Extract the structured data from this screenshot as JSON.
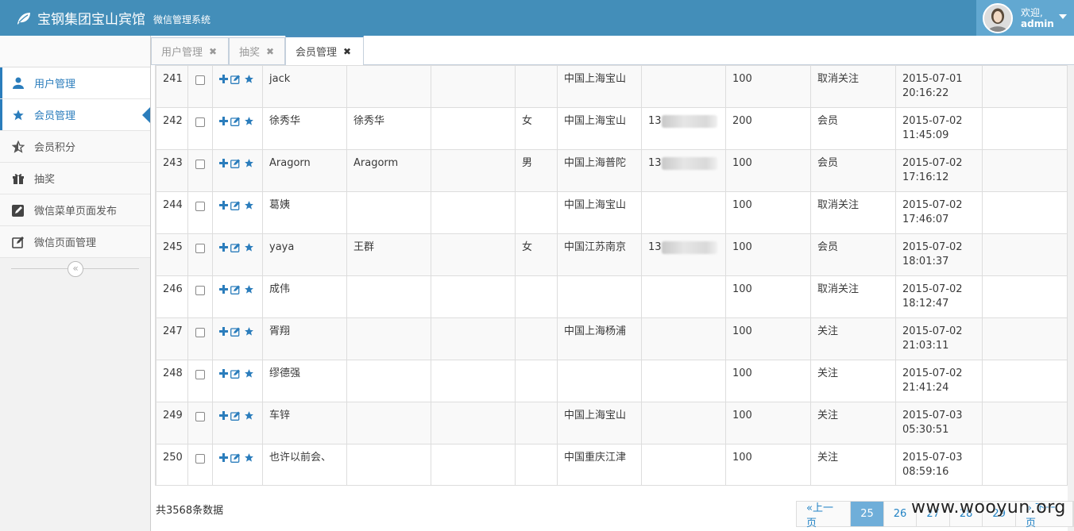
{
  "header": {
    "brand_name": "宝钢集团宝山宾馆",
    "brand_sub": "微信管理系统",
    "welcome": "欢迎,",
    "username": "admin"
  },
  "sidebar": {
    "items": [
      {
        "label": "用户管理",
        "icon": "user-icon"
      },
      {
        "label": "会员管理",
        "icon": "star-icon"
      },
      {
        "label": "会员积分",
        "icon": "star-half-icon"
      },
      {
        "label": "抽奖",
        "icon": "gift-icon"
      },
      {
        "label": "微信菜单页面发布",
        "icon": "pencil-square-icon"
      },
      {
        "label": "微信页面管理",
        "icon": "edit-icon"
      }
    ],
    "collapse_icon": "double-chevron-left-icon"
  },
  "tabs": [
    {
      "label": "用户管理"
    },
    {
      "label": "抽奖"
    },
    {
      "label": "会员管理"
    }
  ],
  "table": {
    "rows": [
      {
        "id": "241",
        "nickname": "jack",
        "name": "",
        "col5": "",
        "gender": "",
        "region": "中国上海宝山",
        "phone": "",
        "points": "100",
        "status": "取消关注",
        "date": "2015-07-01",
        "time": "20:16:22"
      },
      {
        "id": "242",
        "nickname": "徐秀华",
        "name": "徐秀华",
        "col5": "",
        "gender": "女",
        "region": "中国上海宝山",
        "phone": "13",
        "points": "200",
        "status": "会员",
        "date": "2015-07-02",
        "time": "11:45:09"
      },
      {
        "id": "243",
        "nickname": "Aragorn",
        "name": "Aragorm",
        "col5": "",
        "gender": "男",
        "region": "中国上海普陀",
        "phone": "13",
        "points": "100",
        "status": "会员",
        "date": "2015-07-02",
        "time": "17:16:12"
      },
      {
        "id": "244",
        "nickname": "葛姨",
        "name": "",
        "col5": "",
        "gender": "",
        "region": "中国上海宝山",
        "phone": "",
        "points": "100",
        "status": "取消关注",
        "date": "2015-07-02",
        "time": "17:46:07"
      },
      {
        "id": "245",
        "nickname": "yaya",
        "name": "王群",
        "col5": "",
        "gender": "女",
        "region": "中国江苏南京",
        "phone": "13",
        "points": "100",
        "status": "会员",
        "date": "2015-07-02",
        "time": "18:01:37"
      },
      {
        "id": "246",
        "nickname": "成伟",
        "name": "",
        "col5": "",
        "gender": "",
        "region": "",
        "phone": "",
        "points": "100",
        "status": "取消关注",
        "date": "2015-07-02",
        "time": "18:12:47"
      },
      {
        "id": "247",
        "nickname": "胥翔",
        "name": "",
        "col5": "",
        "gender": "",
        "region": "中国上海杨浦",
        "phone": "",
        "points": "100",
        "status": "关注",
        "date": "2015-07-02",
        "time": "21:03:11"
      },
      {
        "id": "248",
        "nickname": "缪德强",
        "name": "",
        "col5": "",
        "gender": "",
        "region": "",
        "phone": "",
        "points": "100",
        "status": "关注",
        "date": "2015-07-02",
        "time": "21:41:24"
      },
      {
        "id": "249",
        "nickname": "车锌",
        "name": "",
        "col5": "",
        "gender": "",
        "region": "中国上海宝山",
        "phone": "",
        "points": "100",
        "status": "关注",
        "date": "2015-07-03",
        "time": "05:30:51"
      },
      {
        "id": "250",
        "nickname": "也许以前会、",
        "name": "",
        "col5": "",
        "gender": "",
        "region": "中国重庆江津",
        "phone": "",
        "points": "100",
        "status": "关注",
        "date": "2015-07-03",
        "time": "08:59:16"
      }
    ],
    "blurred_phone_rows": [
      "242",
      "243",
      "245"
    ]
  },
  "footer": {
    "total": "共3568条数据",
    "pager": [
      "«上一页",
      "25",
      "26",
      "27",
      "28",
      "29",
      "» 下一页"
    ],
    "current_page": "25"
  },
  "watermark": "www.wooyun.org",
  "colors": {
    "navbar": "#438eb9",
    "accent": "#2b7dbc",
    "pager_active": "#6faed9"
  }
}
